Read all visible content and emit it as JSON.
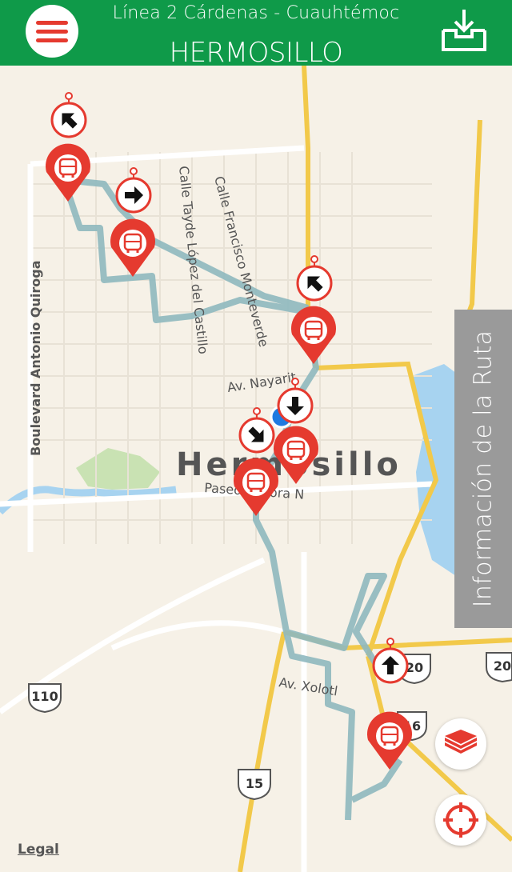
{
  "header": {
    "line_name": "Línea 2 Cárdenas - Cuauhtémoc",
    "city": "HERMOSILLO"
  },
  "map": {
    "city_label": "Hermosillo",
    "streets": {
      "boulevard": "Boulevard Antonio Quiroga",
      "tayde": "Calle Tayde López del Castillo",
      "francisco": "Calle Francisco Monteverde",
      "nayarit": "Av. Nayarit",
      "paseo": "Paseo Sonora N",
      "xolotl": "Av. Xolotl"
    },
    "shields": {
      "s110": "110",
      "s15": "15",
      "s20a": "20",
      "s20b": "20",
      "s16": "16"
    },
    "legal": "Legal"
  },
  "side_panel": {
    "label": "Información de la Ruta"
  },
  "colors": {
    "header_green": "#0f9a49",
    "accent_red": "#e53a2f",
    "route": "#8fb9bf",
    "road_yellow": "#f2c94a",
    "water": "#a7d3f0",
    "park": "#c9e2b3"
  }
}
